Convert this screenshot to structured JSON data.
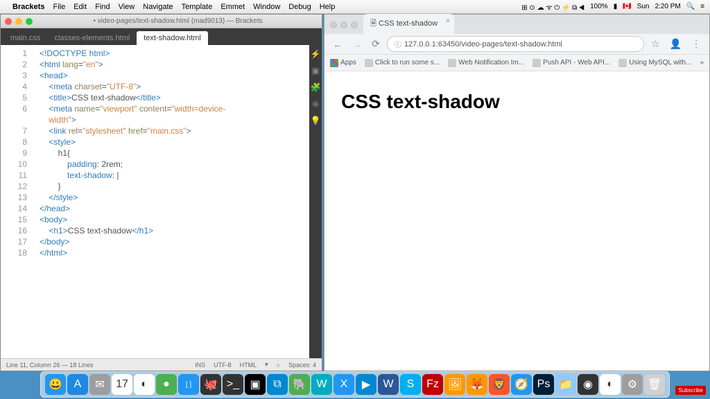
{
  "menubar": {
    "app": "Brackets",
    "items": [
      "File",
      "Edit",
      "Find",
      "View",
      "Navigate",
      "Template",
      "Emmet",
      "Window",
      "Debug",
      "Help"
    ],
    "right": {
      "battery": "100%",
      "flag": "🇨🇦",
      "day": "Sun",
      "time": "2:20 PM"
    }
  },
  "editor": {
    "title": "• video-pages/text-shadow.html (mad9013) — Brackets",
    "tabs": [
      {
        "label": "main.css",
        "active": false
      },
      {
        "label": "classes-elements.html",
        "active": false
      },
      {
        "label": "text-shadow.html",
        "active": true
      }
    ],
    "status": {
      "pos": "Line 11, Column 26 — 18 Lines",
      "ins": "INS",
      "enc": "UTF-8",
      "lang": "HTML",
      "lint": "○",
      "spaces": "Spaces: 4"
    },
    "lines": [
      {
        "n": 1,
        "html": "<span class='c-tag'>&lt;!DOCTYPE html&gt;</span>"
      },
      {
        "n": 2,
        "html": "<span class='c-tag'>&lt;html</span> <span class='c-attr'>lang</span>=<span class='c-str'>\"en\"</span><span class='c-tag'>&gt;</span>"
      },
      {
        "n": 3,
        "html": "<span class='c-tag'>&lt;head&gt;</span>"
      },
      {
        "n": 4,
        "html": "    <span class='c-tag'>&lt;meta</span> <span class='c-attr'>charset</span>=<span class='c-str'>\"UTF-8\"</span><span class='c-tag'>&gt;</span>"
      },
      {
        "n": 5,
        "html": "    <span class='c-tag'>&lt;title&gt;</span>CSS text-shadow<span class='c-tag'>&lt;/title&gt;</span>"
      },
      {
        "n": 6,
        "html": "    <span class='c-tag'>&lt;meta</span> <span class='c-attr'>name</span>=<span class='c-str'>\"viewport\"</span> <span class='c-attr'>content</span>=<span class='c-str'>\"width=device-\n    width\"</span><span class='c-tag'>&gt;</span>"
      },
      {
        "n": 7,
        "html": "    <span class='c-tag'>&lt;link</span> <span class='c-attr'>rel</span>=<span class='c-str'>\"stylesheet\"</span> <span class='c-attr'>href</span>=<span class='c-str'>\"main.css\"</span><span class='c-tag'>&gt;</span>"
      },
      {
        "n": 8,
        "html": "    <span class='c-tag'>&lt;style&gt;</span>"
      },
      {
        "n": 9,
        "html": "        h1{"
      },
      {
        "n": 10,
        "html": "            <span class='c-kw'>padding</span>: 2rem;"
      },
      {
        "n": 11,
        "html": "            <span class='c-kw'>text-shadow</span>: |"
      },
      {
        "n": 12,
        "html": "        }"
      },
      {
        "n": 13,
        "html": "    <span class='c-tag'>&lt;/style&gt;</span>"
      },
      {
        "n": 14,
        "html": "<span class='c-tag'>&lt;/head&gt;</span>"
      },
      {
        "n": 15,
        "html": "<span class='c-tag'>&lt;body&gt;</span>"
      },
      {
        "n": 16,
        "html": "    <span class='c-tag'>&lt;h1&gt;</span>CSS text-shadow<span class='c-tag'>&lt;/h1&gt;</span>"
      },
      {
        "n": 17,
        "html": "<span class='c-tag'>&lt;/body&gt;</span>"
      },
      {
        "n": 18,
        "html": "<span class='c-tag'>&lt;/html&gt;</span>"
      }
    ]
  },
  "browser": {
    "tab_title": "CSS text-shadow",
    "url": "127.0.0.1:63450/video-pages/text-shadow.html",
    "bookmarks": [
      {
        "label": "Apps"
      },
      {
        "label": "Click to run some s..."
      },
      {
        "label": "Web Notification Im..."
      },
      {
        "label": "Push API - Web API..."
      },
      {
        "label": "Using MySQL with..."
      }
    ],
    "page_heading": "CSS text-shadow"
  },
  "dock": {
    "icons": [
      {
        "name": "finder",
        "bg": "#2196f3",
        "glyph": "😀"
      },
      {
        "name": "appstore",
        "bg": "#1e88e5",
        "glyph": "A"
      },
      {
        "name": "mail",
        "bg": "#9e9e9e",
        "glyph": "✉"
      },
      {
        "name": "calendar",
        "bg": "#fff",
        "glyph": "17"
      },
      {
        "name": "chrome",
        "bg": "#fff",
        "glyph": "◐"
      },
      {
        "name": "mongodb",
        "bg": "#4caf50",
        "glyph": "●"
      },
      {
        "name": "brackets",
        "bg": "#2196f3",
        "glyph": "[ ]"
      },
      {
        "name": "github",
        "bg": "#333",
        "glyph": "🐙"
      },
      {
        "name": "terminal",
        "bg": "#333",
        "glyph": ">_"
      },
      {
        "name": "hyper",
        "bg": "#000",
        "glyph": "▣"
      },
      {
        "name": "vscode",
        "bg": "#0288d1",
        "glyph": "⧉"
      },
      {
        "name": "evernote",
        "bg": "#4caf50",
        "glyph": "🐘"
      },
      {
        "name": "webstorm",
        "bg": "#00acc1",
        "glyph": "W"
      },
      {
        "name": "xcode",
        "bg": "#2196f3",
        "glyph": "X"
      },
      {
        "name": "keynote",
        "bg": "#0288d1",
        "glyph": "▶"
      },
      {
        "name": "word",
        "bg": "#2b579a",
        "glyph": "W"
      },
      {
        "name": "skype",
        "bg": "#00aff0",
        "glyph": "S"
      },
      {
        "name": "filezilla",
        "bg": "#bf0000",
        "glyph": "Fz"
      },
      {
        "name": "preview",
        "bg": "#ff9800",
        "glyph": "🖼"
      },
      {
        "name": "firefox",
        "bg": "#ff9800",
        "glyph": "🦊"
      },
      {
        "name": "brave",
        "bg": "#fb542b",
        "glyph": "🦁"
      },
      {
        "name": "safari",
        "bg": "#2196f3",
        "glyph": "🧭"
      },
      {
        "name": "photoshop",
        "bg": "#001e36",
        "glyph": "Ps"
      },
      {
        "name": "folder",
        "bg": "#90caf9",
        "glyph": "📁"
      },
      {
        "name": "obs",
        "bg": "#333",
        "glyph": "◉"
      },
      {
        "name": "chrome2",
        "bg": "#fff",
        "glyph": "◐"
      },
      {
        "name": "settings",
        "bg": "#9e9e9e",
        "glyph": "⚙"
      },
      {
        "name": "trash",
        "bg": "#d0d0d0",
        "glyph": "🗑"
      }
    ]
  },
  "subscribe": "Subscribe"
}
